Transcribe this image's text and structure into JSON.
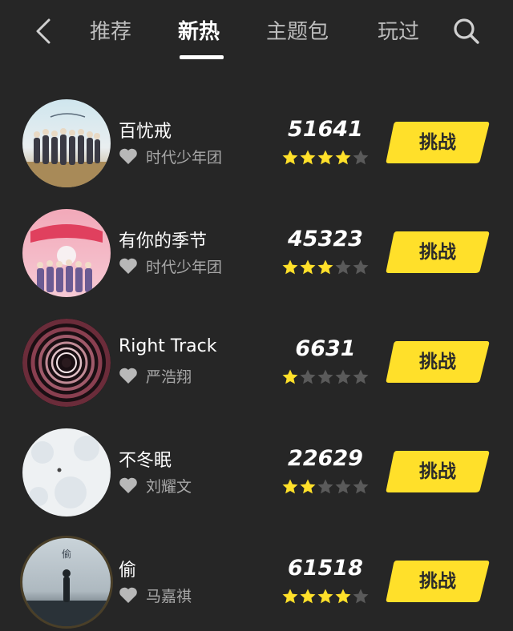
{
  "header": {
    "tabs": [
      {
        "label": "推荐",
        "active": false
      },
      {
        "label": "新热",
        "active": true
      },
      {
        "label": "主题包",
        "active": false
      },
      {
        "label": "玩过",
        "active": false
      }
    ]
  },
  "icons": {
    "back": "chevron-left-icon",
    "search": "search-icon",
    "like": "heart-icon",
    "rating": "star-icon"
  },
  "colors": {
    "background": "#262626",
    "accent_yellow": "#ffe02a",
    "star_filled": "#ffe02a",
    "star_empty": "#5a5a5a",
    "text_secondary": "#a8a8a8"
  },
  "songs": [
    {
      "title": "百忧戒",
      "artist": "时代少年团",
      "score": "51641",
      "stars": 4,
      "max_stars": 5,
      "button": "挑战"
    },
    {
      "title": "有你的季节",
      "artist": "时代少年团",
      "score": "45323",
      "stars": 3,
      "max_stars": 5,
      "button": "挑战"
    },
    {
      "title": "Right Track",
      "artist": "严浩翔",
      "score": "6631",
      "stars": 1,
      "max_stars": 5,
      "button": "挑战"
    },
    {
      "title": "不冬眠",
      "artist": "刘耀文",
      "score": "22629",
      "stars": 2,
      "max_stars": 5,
      "button": "挑战"
    },
    {
      "title": "偷",
      "artist": "马嘉祺",
      "score": "61518",
      "stars": 4,
      "max_stars": 5,
      "button": "挑战"
    }
  ]
}
